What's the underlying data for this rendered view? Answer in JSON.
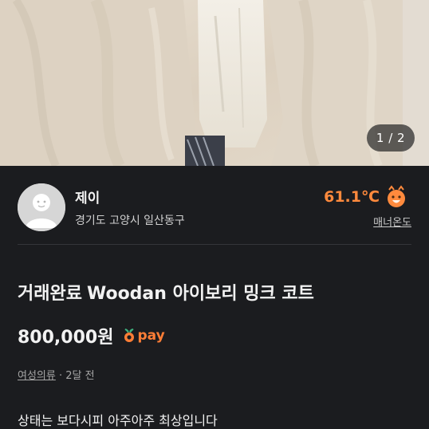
{
  "photo": {
    "counter": "1 / 2",
    "description_icon": "product-photo"
  },
  "seller": {
    "name": "제이",
    "location": "경기도 고양시 일산동구",
    "temperature": "61.1℃",
    "manner_label": "매너온도",
    "temperature_color": "#ff8a3d"
  },
  "item": {
    "status": "거래완료",
    "name": "Woodan 아이보리 밍크 코트",
    "price": "800,000원",
    "pay_label": "pay",
    "category": "여성의류",
    "separator": " · ",
    "posted": "2달 전",
    "description": "상태는 보다시피 아주아주 최상입니다"
  },
  "colors": {
    "background": "#1b1c1f",
    "accent": "#ff7e36"
  }
}
